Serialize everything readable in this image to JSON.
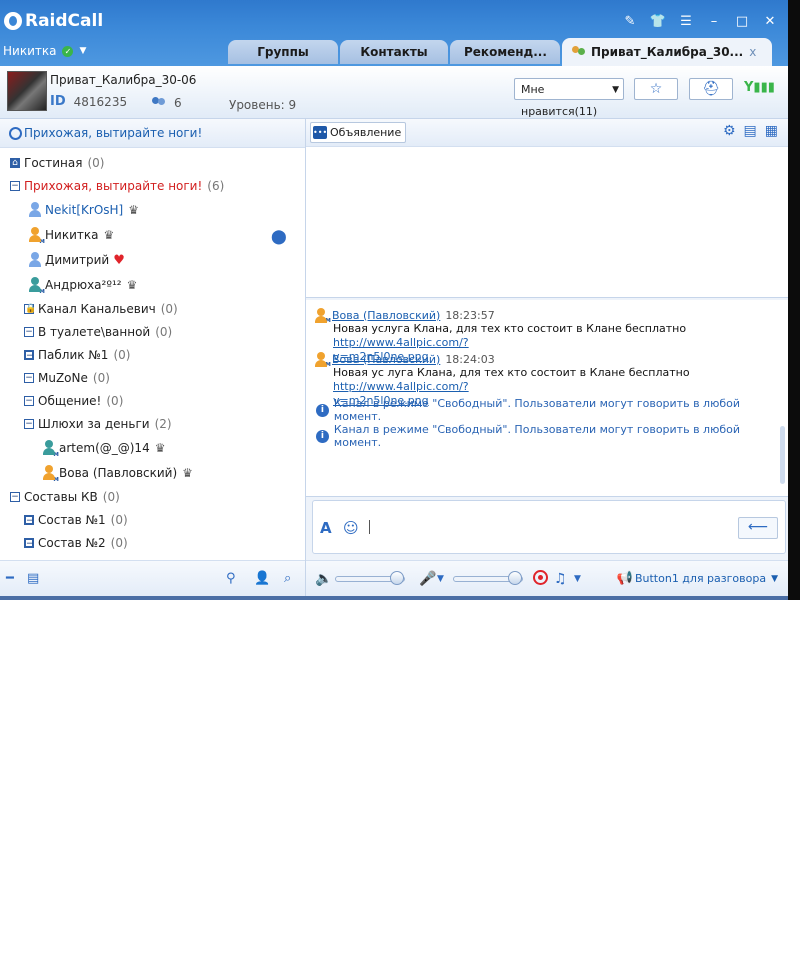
{
  "app": {
    "name": "RaidCall",
    "user": "Никитка"
  },
  "tabs": [
    {
      "label": "Группы"
    },
    {
      "label": "Контакты"
    },
    {
      "label": "Рекоменд..."
    },
    {
      "label": "Приват_Калибра_30..."
    }
  ],
  "tab_close": "x",
  "channel": {
    "name": "Приват_Калибра_30-06",
    "id_label": "ID",
    "id": "4816235",
    "members": "6",
    "level": "Уровень: 9",
    "like": "Мне нравится(11)"
  },
  "left": {
    "header": "Прихожая, вытирайте ноги!"
  },
  "tree": [
    {
      "label": "Гостиная",
      "count": "(0)"
    },
    {
      "label": "Прихожая, вытирайте ноги!",
      "count": "(6)"
    },
    {
      "label": "Nekit[KrOsH]"
    },
    {
      "label": "Никитка"
    },
    {
      "label": "Димитрий"
    },
    {
      "label": "Андрюха²º¹²"
    },
    {
      "label": "Канал Канальевич",
      "count": "(0)"
    },
    {
      "label": "В туалете\\ванной",
      "count": "(0)"
    },
    {
      "label": "Паблик №1",
      "count": "(0)"
    },
    {
      "label": "MuZoNe",
      "count": "(0)"
    },
    {
      "label": "Общение!",
      "count": "(0)"
    },
    {
      "label": "Шлюхи за деньги",
      "count": "(2)"
    },
    {
      "label": "artem(@_@)14"
    },
    {
      "label": "Вова (Павловский)"
    },
    {
      "label": "Составы КВ",
      "count": "(0)"
    },
    {
      "label": "Состав №1",
      "count": "(0)"
    },
    {
      "label": "Состав №2",
      "count": "(0)"
    }
  ],
  "announcement_label": "Объявление",
  "messages": [
    {
      "author": "Вова (Павловский)",
      "time": "18:23:57",
      "text": "Новая услуга Клана, для тех кто состоит в Клане бесплатно",
      "link1": "http://www.4allpic.com/?",
      "link2": "v=m2n5l0ne.png"
    },
    {
      "author": "Вова (Павловский)",
      "time": "18:24:03",
      "text": "Новая ус луга Клана, для тех кто состоит в Клане бесплатно",
      "link1": "http://www.4allpic.com/?",
      "link2": "v=m2n5l0ne.png"
    }
  ],
  "system_messages": [
    "Канал в режиме \"Свободный\". Пользователи могут говорить в любой момент.",
    "Канал в режиме \"Свободный\". Пользователи могут говорить в любой момент."
  ],
  "voice": {
    "mode": "Button1 для разговора"
  },
  "volume": {
    "speaker": 1.0,
    "mic": 1.0
  }
}
